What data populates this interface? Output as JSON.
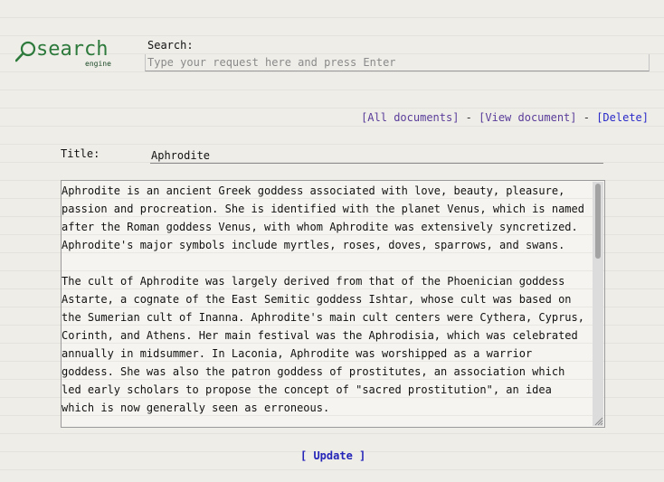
{
  "logo": {
    "word": "search",
    "subtitle": "engine",
    "color": "#2d7a3c"
  },
  "search": {
    "label": "Search:",
    "placeholder": "Type your request here and press Enter",
    "value": ""
  },
  "doc_links": {
    "all_documents": "[All documents]",
    "separator_1": " - ",
    "view_document": "[View document]",
    "separator_2": " - ",
    "delete": "[Delete]"
  },
  "document": {
    "title_label": "Title:",
    "title_value": "Aphrodite",
    "content": "Aphrodite is an ancient Greek goddess associated with love, beauty, pleasure, passion and procreation. She is identified with the planet Venus, which is named after the Roman goddess Venus, with whom Aphrodite was extensively syncretized. Aphrodite's major symbols include myrtles, roses, doves, sparrows, and swans.\n\nThe cult of Aphrodite was largely derived from that of the Phoenician goddess Astarte, a cognate of the East Semitic goddess Ishtar, whose cult was based on the Sumerian cult of Inanna. Aphrodite's main cult centers were Cythera, Cyprus, Corinth, and Athens. Her main festival was the Aphrodisia, which was celebrated annually in midsummer. In Laconia, Aphrodite was worshipped as a warrior goddess. She was also the patron goddess of prostitutes, an association which led early scholars to propose the concept of \"sacred prostitution\", an idea which is now generally seen as erroneous."
  },
  "actions": {
    "update_label": "[ Update ]"
  }
}
